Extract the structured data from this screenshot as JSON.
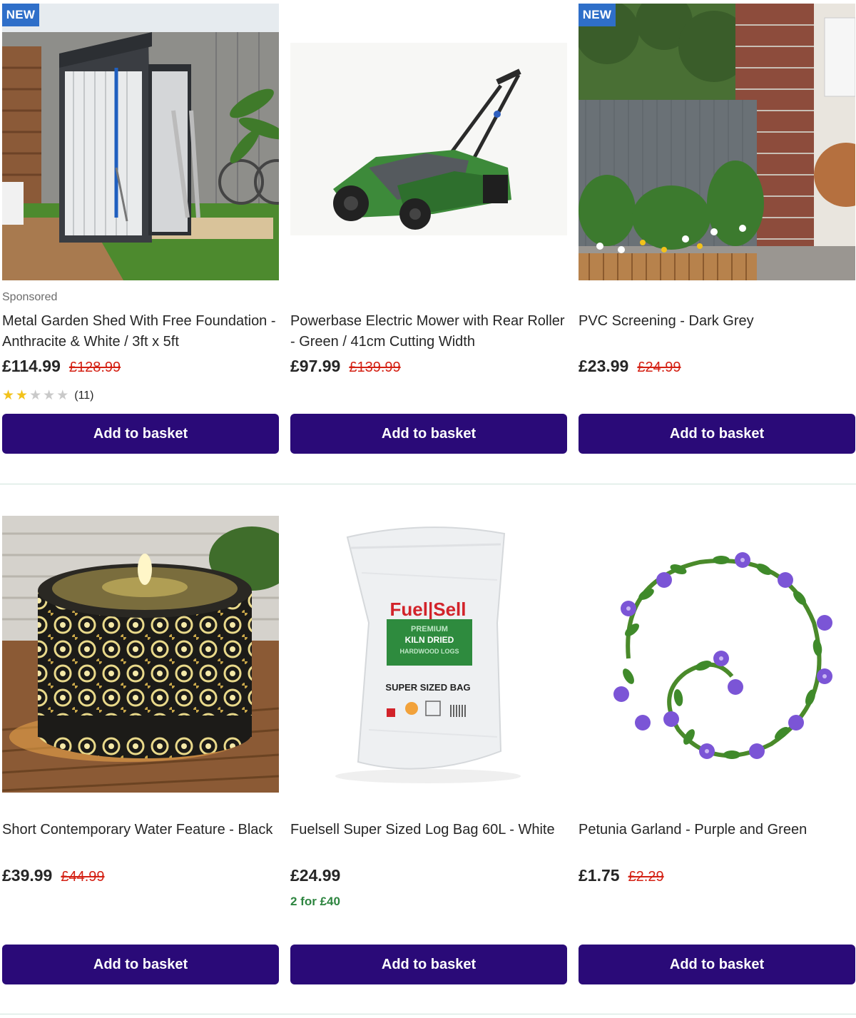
{
  "products": [
    {
      "badge": "NEW",
      "sponsored": "Sponsored",
      "title": "Metal Garden Shed With Free Foundation - Anthracite & White / 3ft x 5ft",
      "price": "£114.99",
      "was_price": "£128.99",
      "rating": {
        "stars": 2,
        "max": 5,
        "count": "(11)"
      },
      "button_label": "Add to basket"
    },
    {
      "title": "Powerbase Electric Mower with Rear Roller - Green / 41cm Cutting Width",
      "price": "£97.99",
      "was_price": "£139.99",
      "button_label": "Add to basket"
    },
    {
      "badge": "NEW",
      "title": "PVC Screening - Dark Grey",
      "price": "£23.99",
      "was_price": "£24.99",
      "button_label": "Add to basket"
    },
    {
      "title": "Short Contemporary Water Feature - Black",
      "price": "£39.99",
      "was_price": "£44.99",
      "button_label": "Add to basket"
    },
    {
      "title": "Fuelsell Super Sized Log Bag 60L - White",
      "price": "£24.99",
      "promo": "2 for £40",
      "button_label": "Add to basket",
      "bag_text": {
        "brand": "Fuel|Sell",
        "line1": "PREMIUM",
        "line2": "KILN DRIED",
        "line3": "HARDWOOD LOGS",
        "size": "SUPER SIZED BAG"
      }
    },
    {
      "title": "Petunia Garland - Purple and Green",
      "price": "£1.75",
      "was_price": "£2.29",
      "button_label": "Add to basket"
    }
  ],
  "colors": {
    "button": "#2a0a78",
    "badge": "#2f6fc9",
    "was_price": "#d42114",
    "promo": "#2e8540",
    "star": "#f2c21b"
  }
}
